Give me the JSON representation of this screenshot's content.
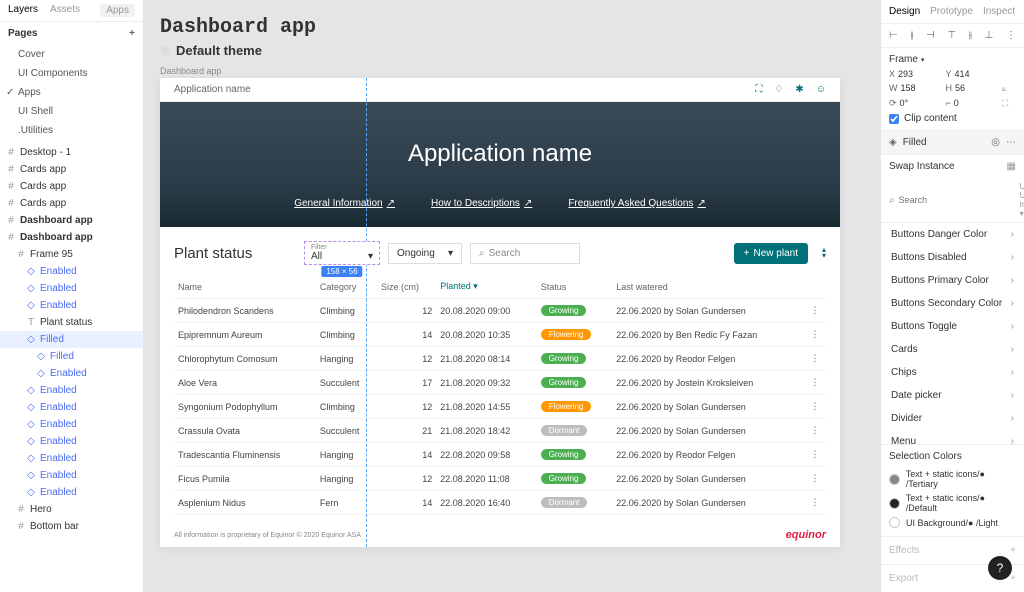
{
  "left": {
    "tabs": {
      "layers": "Layers",
      "assets": "Assets",
      "lib": "Apps"
    },
    "pages_label": "Pages",
    "pages": [
      "Cover",
      "UI Components",
      "Apps",
      "UI Shell",
      ".Utilities"
    ],
    "pages_selected": 2,
    "layers": [
      {
        "ic": "#",
        "txt": "Desktop - 1",
        "lvl": 1
      },
      {
        "ic": "#",
        "txt": "Cards app",
        "lvl": 1,
        "cls": "gold"
      },
      {
        "ic": "#",
        "txt": "Cards app",
        "lvl": 1
      },
      {
        "ic": "#",
        "txt": "Cards app",
        "lvl": 1
      },
      {
        "ic": "#",
        "txt": "Dashboard app",
        "lvl": 1,
        "bold": true
      },
      {
        "ic": "#",
        "txt": "Dashboard app",
        "lvl": 1,
        "bold": true
      },
      {
        "ic": "#",
        "txt": "Frame 95",
        "lvl": 2
      },
      {
        "ic": "◇",
        "txt": "Enabled",
        "lvl": 3,
        "blue": true
      },
      {
        "ic": "◇",
        "txt": "Enabled",
        "lvl": 3,
        "blue": true
      },
      {
        "ic": "◇",
        "txt": "Enabled",
        "lvl": 3,
        "blue": true
      },
      {
        "ic": "T",
        "txt": "Plant status",
        "lvl": 3
      },
      {
        "ic": "◇",
        "txt": "Filled",
        "lvl": 3,
        "blue": true,
        "sel": true
      },
      {
        "ic": "◇",
        "txt": "Filled",
        "lvl": 4,
        "blue": true
      },
      {
        "ic": "◇",
        "txt": "Enabled",
        "lvl": 4,
        "blue": true
      },
      {
        "ic": "◇",
        "txt": "Enabled",
        "lvl": 3,
        "blue": true
      },
      {
        "ic": "◇",
        "txt": "Enabled",
        "lvl": 3,
        "blue": true
      },
      {
        "ic": "◇",
        "txt": "Enabled",
        "lvl": 3,
        "blue": true
      },
      {
        "ic": "◇",
        "txt": "Enabled",
        "lvl": 3,
        "blue": true
      },
      {
        "ic": "◇",
        "txt": "Enabled",
        "lvl": 3,
        "blue": true
      },
      {
        "ic": "◇",
        "txt": "Enabled",
        "lvl": 3,
        "blue": true
      },
      {
        "ic": "◇",
        "txt": "Enabled",
        "lvl": 3,
        "blue": true
      },
      {
        "ic": "#",
        "txt": "Hero",
        "lvl": 2
      },
      {
        "ic": "#",
        "txt": "Bottom bar",
        "lvl": 2
      }
    ]
  },
  "canvas": {
    "title": "Dashboard app",
    "subtitle": "Default theme",
    "frame_label": "Dashboard app",
    "app_name": "Application name",
    "hero_title": "Application name",
    "hero_links": [
      "General Information",
      "How to Descriptions",
      "Frequently Asked Questions"
    ],
    "status_title": "Plant status",
    "filter_label": "Filter",
    "filter_value": "All",
    "filter_badge": "158 × 56",
    "ongoing": "Ongoing",
    "search_ph": "Search",
    "new_btn": "New plant",
    "cols": [
      "Name",
      "Category",
      "Size (cm)",
      "Planted",
      "Status",
      "Last watered"
    ],
    "rows": [
      {
        "name": "Philodendron Scandens",
        "cat": "Climbing",
        "size": "12",
        "planted": "20.08.2020 09:00",
        "status": "Growing",
        "st": "grow",
        "water": "22.06.2020 by Solan Gundersen"
      },
      {
        "name": "Epipremnum Aureum",
        "cat": "Climbing",
        "size": "14",
        "planted": "20.08.2020 10:35",
        "status": "Flowering",
        "st": "flow",
        "water": "22.06.2020 by Ben Redic Fy Fazan"
      },
      {
        "name": "Chlorophytum Comosum",
        "cat": "Hanging",
        "size": "12",
        "planted": "21.08.2020 08:14",
        "status": "Growing",
        "st": "grow",
        "water": "22.06.2020 by Reodor Felgen"
      },
      {
        "name": "Aloe Vera",
        "cat": "Succulent",
        "size": "17",
        "planted": "21.08.2020 09:32",
        "status": "Growing",
        "st": "grow",
        "water": "22.06.2020 by Jostein Kroksleiven"
      },
      {
        "name": "Syngonium Podophyllum",
        "cat": "Climbing",
        "size": "12",
        "planted": "21.08.2020 14:55",
        "status": "Flowering",
        "st": "flow",
        "water": "22.06.2020 by Solan Gundersen"
      },
      {
        "name": "Crassula Ovata",
        "cat": "Succulent",
        "size": "21",
        "planted": "21.08.2020 18:42",
        "status": "Dormant",
        "st": "dorm",
        "water": "22.06.2020 by Solan Gundersen"
      },
      {
        "name": "Tradescantia Fluminensis",
        "cat": "Hanging",
        "size": "14",
        "planted": "22.08.2020 09:58",
        "status": "Growing",
        "st": "grow",
        "water": "22.06.2020 by Reodor Felgen"
      },
      {
        "name": "Ficus Pumila",
        "cat": "Hanging",
        "size": "12",
        "planted": "22.08.2020 11:08",
        "status": "Growing",
        "st": "grow",
        "water": "22.06.2020 by Solan Gundersen"
      },
      {
        "name": "Asplenium Nidus",
        "cat": "Fern",
        "size": "14",
        "planted": "22.08.2020 16:40",
        "status": "Dormant",
        "st": "dorm",
        "water": "22.06.2020 by Solan Gundersen"
      }
    ],
    "legal": "All information is proprietary of Equinor © 2020 Equinor ASA",
    "logo": "equinor"
  },
  "right": {
    "tabs": {
      "design": "Design",
      "proto": "Prototype",
      "inspect": "Inspect"
    },
    "frame_label": "Frame",
    "xywh": {
      "x": "293",
      "y": "414",
      "w": "158",
      "h": "56",
      "r": "0°",
      "c": "0"
    },
    "clip": "Clip content",
    "filled": "Filled",
    "swap_label": "Swap Instance",
    "search_ph": "Search",
    "lib": "UI—User Int…",
    "components": [
      "Buttons Danger Color",
      "Buttons Disabled",
      "Buttons Primary Color",
      "Buttons Secondary Color",
      "Buttons Toggle",
      "Cards",
      "Chips",
      "Date picker",
      "Divider",
      "Menu"
    ],
    "sel_colors_label": "Selection Colors",
    "sel_colors": [
      {
        "c": "#888",
        "t": "Text + static icons/● /Tertiary"
      },
      {
        "c": "#222",
        "t": "Text + static icons/● /Default"
      },
      {
        "c": "#fff",
        "t": "UI Background/● /Light"
      }
    ],
    "effects": "Effects",
    "export": "Export"
  }
}
